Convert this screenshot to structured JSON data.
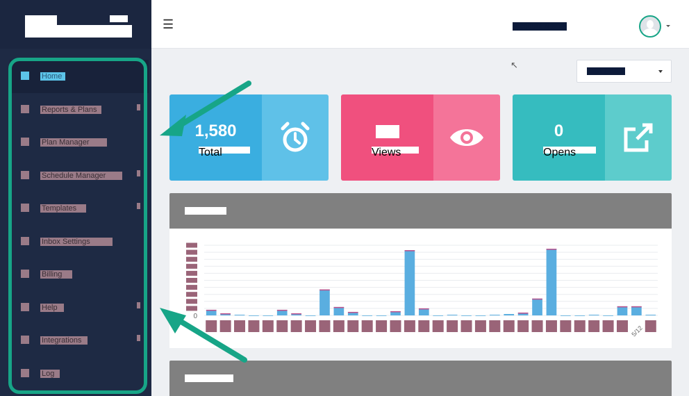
{
  "sidebar": {
    "items": [
      {
        "label": "Home"
      },
      {
        "label": "Reports & Plans"
      },
      {
        "label": "Plan Manager"
      },
      {
        "label": "Schedule Manager"
      },
      {
        "label": "Templates"
      },
      {
        "label": "Inbox Settings"
      },
      {
        "label": "Billing"
      },
      {
        "label": "Help"
      },
      {
        "label": "Integrations"
      },
      {
        "label": "Log"
      }
    ]
  },
  "header": {
    "menu_icon": "hamburger-icon",
    "user_name": "Account Name"
  },
  "filter": {
    "selected": "Last 7 days"
  },
  "stats": [
    {
      "value": "1,580",
      "label": "Total",
      "icon": "alarm-clock-icon",
      "left_color": "#3aaee0",
      "right_color": "#5fc1e8"
    },
    {
      "value": "",
      "label": "Views",
      "icon": "eye-icon",
      "left_color": "#f0507e",
      "right_color": "#f47499"
    },
    {
      "value": "0",
      "label": "Opens",
      "icon": "external-link-icon",
      "left_color": "#36bcbf",
      "right_color": "#5dcccc"
    }
  ],
  "panels": [
    {
      "title": "Daily Activity"
    },
    {
      "title": "Recent Activity"
    }
  ],
  "chart_data": {
    "type": "bar",
    "x": [
      "",
      "",
      "",
      "",
      "",
      "",
      "",
      "",
      "",
      "",
      "",
      "",
      "",
      "",
      "",
      "",
      "",
      "",
      "",
      "",
      "",
      "",
      "",
      "",
      "",
      "",
      "",
      "",
      "",
      "",
      "5/12",
      ""
    ],
    "series": [
      {
        "values": [
          8,
          3,
          1,
          0,
          0,
          8,
          3,
          0,
          37,
          12,
          5,
          0,
          0,
          6,
          93,
          10,
          0,
          1,
          0,
          0,
          1,
          2,
          4,
          24,
          95,
          0,
          0,
          1,
          0,
          13,
          13,
          1
        ]
      }
    ],
    "ylim": [
      0,
      100
    ],
    "y_tick_label": "0",
    "grid": true,
    "bar_color": "#5aaee0",
    "accent_color": "#c0508a"
  },
  "annotation": {
    "ring_color": "#17a587"
  }
}
